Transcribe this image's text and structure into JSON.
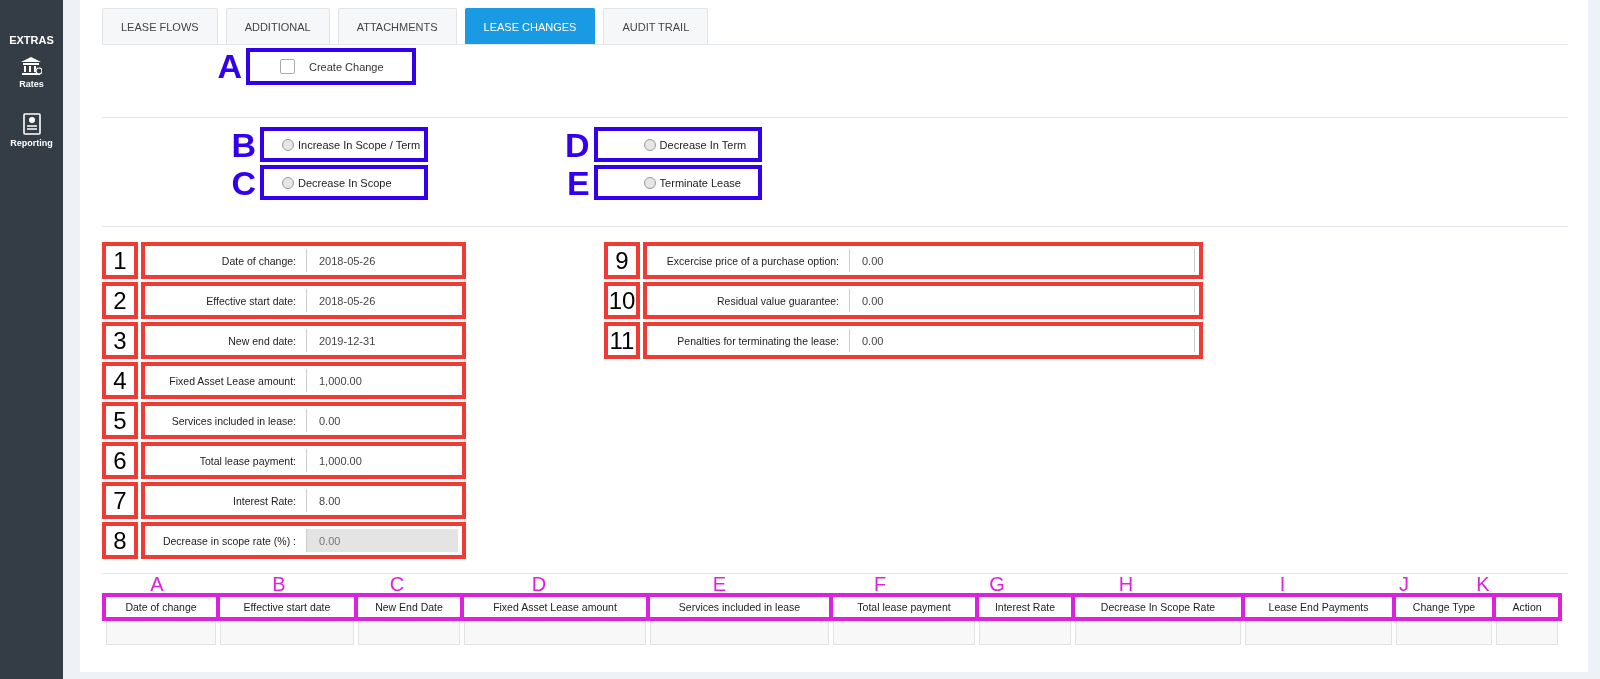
{
  "sidebar": {
    "section": "EXTRAS",
    "items": [
      {
        "label": "Rates",
        "kind": "bank"
      },
      {
        "label": "Reporting",
        "kind": "report"
      }
    ]
  },
  "tabs": [
    {
      "label": "LEASE FLOWS",
      "selected": false
    },
    {
      "label": "ADDITIONAL",
      "selected": false
    },
    {
      "label": "ATTACHMENTS",
      "selected": false
    },
    {
      "label": "LEASE CHANGES",
      "selected": true
    },
    {
      "label": "AUDIT TRAIL",
      "selected": false
    }
  ],
  "create_change": {
    "marker": "A",
    "label": "Create Change",
    "checked": false
  },
  "change_types": [
    {
      "marker": "B",
      "label": "Increase In Scope / Term",
      "selected": false
    },
    {
      "marker": "D",
      "label": "Decrease In Term",
      "selected": false
    },
    {
      "marker": "C",
      "label": "Decrease In Scope",
      "selected": false
    },
    {
      "marker": "E",
      "label": "Terminate Lease",
      "selected": false
    }
  ],
  "fields_left": [
    {
      "marker": "1",
      "label": "Date of change:",
      "value": "2018-05-26",
      "disabled": false
    },
    {
      "marker": "2",
      "label": "Effective start date:",
      "value": "2018-05-26",
      "disabled": false
    },
    {
      "marker": "3",
      "label": "New end date:",
      "value": "2019-12-31",
      "disabled": false
    },
    {
      "marker": "4",
      "label": "Fixed Asset Lease amount:",
      "value": "1,000.00",
      "disabled": false
    },
    {
      "marker": "5",
      "label": "Services included in lease:",
      "value": "0.00",
      "disabled": false
    },
    {
      "marker": "6",
      "label": "Total lease payment:",
      "value": "1,000.00",
      "disabled": false
    },
    {
      "marker": "7",
      "label": "Interest Rate:",
      "value": "8.00",
      "disabled": false
    },
    {
      "marker": "8",
      "label": "Decrease in scope rate (%) :",
      "value": "0.00",
      "disabled": true
    }
  ],
  "fields_right": [
    {
      "marker": "9",
      "label": "Excercise price of a purchase option:",
      "value": "0.00",
      "disabled": false
    },
    {
      "marker": "10",
      "label": "Residual value guarantee:",
      "value": "0.00",
      "disabled": false
    },
    {
      "marker": "11",
      "label": "Penalties for terminating the lease:",
      "value": "0.00",
      "disabled": false
    }
  ],
  "table": {
    "columns": [
      {
        "marker": "A",
        "label": "Date of change"
      },
      {
        "marker": "B",
        "label": "Effective start date"
      },
      {
        "marker": "C",
        "label": "New End Date"
      },
      {
        "marker": "D",
        "label": "Fixed Asset Lease amount"
      },
      {
        "marker": "E",
        "label": "Services included in lease"
      },
      {
        "marker": "F",
        "label": "Total lease payment"
      },
      {
        "marker": "G",
        "label": "Interest Rate"
      },
      {
        "marker": "H",
        "label": "Decrease In Scope Rate"
      },
      {
        "marker": "I",
        "label": "Lease End Payments"
      },
      {
        "marker": "J",
        "label": "Change Type"
      },
      {
        "marker": "K",
        "label": "Action"
      }
    ]
  }
}
